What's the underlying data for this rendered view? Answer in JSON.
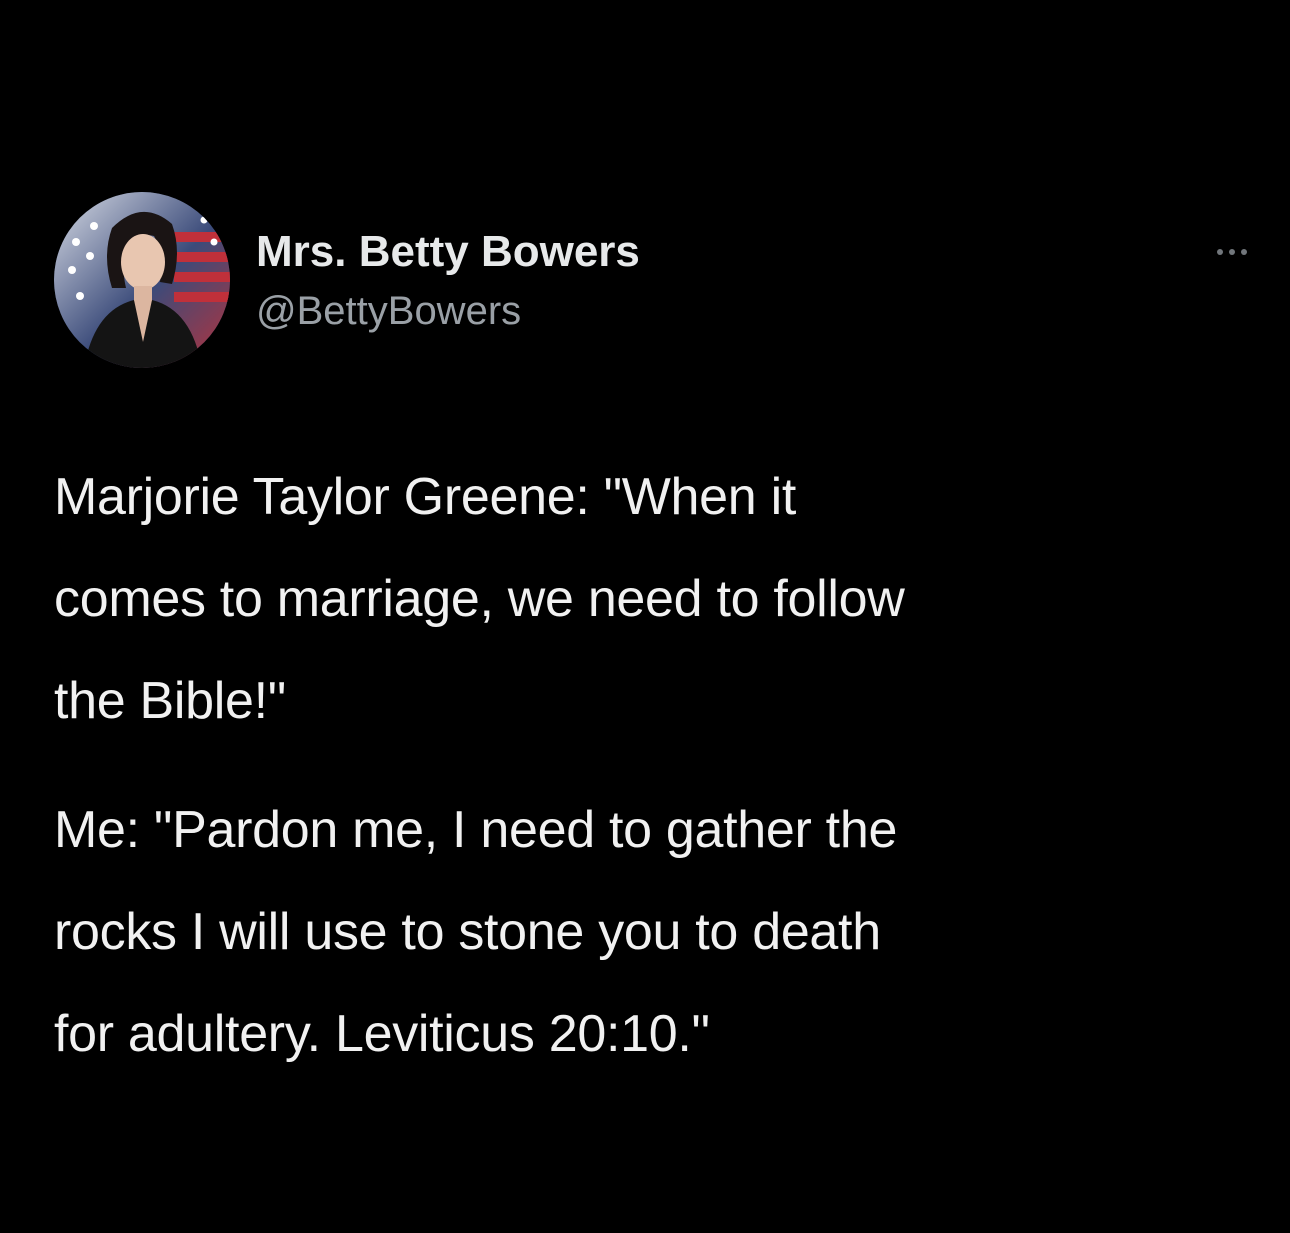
{
  "tweet": {
    "author": {
      "display_name": "Mrs. Betty Bowers",
      "handle": "@BettyBowers"
    },
    "more_icon": "ellipsis-icon",
    "paragraphs": [
      "Marjorie Taylor Greene: \"When it\ncomes to marriage, we need to follow\nthe Bible!\"",
      "Me: \"Pardon me, I need to gather the\nrocks I will use to stone you to death\nfor adultery. Leviticus 20:10.\""
    ]
  },
  "colors": {
    "background": "#000000",
    "text_primary": "#e7e9ea",
    "text_secondary": "#9aa0a6"
  }
}
